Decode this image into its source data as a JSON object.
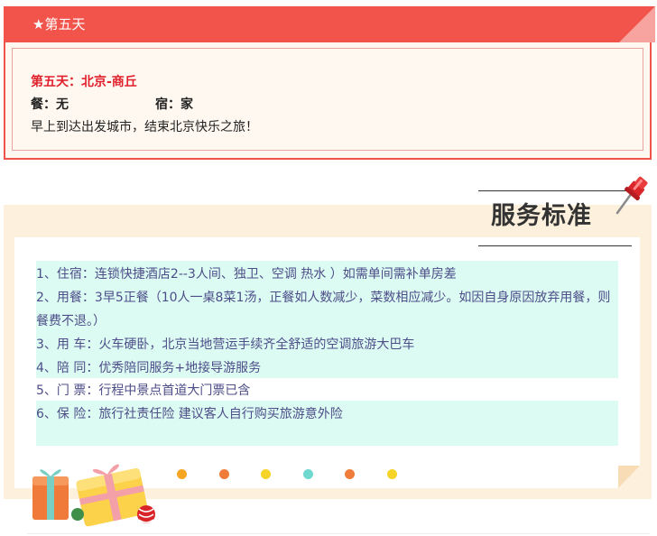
{
  "day": {
    "header": "★第五天",
    "route": "第五天：北京-商丘",
    "meals": "餐：无",
    "hotel": "宿：家",
    "description": "早上到达出发城市，结束北京快乐之旅！"
  },
  "service": {
    "title": "服务标准",
    "items": [
      "1、住宿：连锁快捷酒店2--3人间、独卫、空调   热水 ）如需单间需补单房差",
      "2、用餐：3早5正餐（10人一桌8菜1汤，正餐如人数减少，菜数相应减少。如因自身原因放弃用餐，则餐费不退。）",
      "3、用 车：火车硬卧，北京当地营运手续齐全舒适的空调旅游大巴车",
      "4、陪 同：优秀陪同服务+地接导游服务",
      "5、门 票：行程中景点首道大门票已含",
      "6、保 险：旅行社责任险 建议客人自行购买旅游意外险"
    ]
  },
  "colors": {
    "accent_red": "#f2534b",
    "route_red": "#e0202c",
    "item_text": "#4d4d88",
    "item_highlight": "#dcfbf3",
    "section_bg": "#fdf0dc",
    "dots": [
      "#f6a623",
      "#f07c3a",
      "#f5d327",
      "#6fd8cf",
      "#f07c3a",
      "#f5d327"
    ]
  },
  "icons": {
    "pin": "pushpin-icon",
    "gifts": "gift-boxes-icon",
    "corner": "page-fold-icon"
  }
}
